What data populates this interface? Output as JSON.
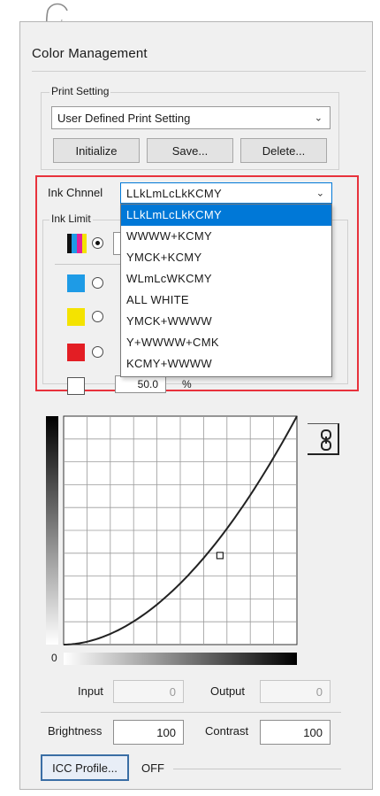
{
  "window": {
    "title": "Color Management"
  },
  "print_setting": {
    "legend": "Print Setting",
    "selected": "User Defined Print Setting",
    "buttons": {
      "initialize": "Initialize",
      "save": "Save...",
      "delete": "Delete..."
    }
  },
  "ink_channel": {
    "label": "Ink Chnnel",
    "selected": "LLkLmLcLkKCMY",
    "options": [
      "LLkLmLcLkKCMY",
      "WWWW+KCMY",
      "YMCK+KCMY",
      "WLmLcWKCMY",
      "ALL WHITE",
      "YMCK+WWWW",
      "Y+WWWW+CMK",
      "KCMY+WWWW"
    ]
  },
  "ink_limit": {
    "legend": "Ink Limit",
    "channels": [
      {
        "name": "all-colors",
        "selected": true
      },
      {
        "name": "cyan",
        "color": "#1e9be6",
        "selected": false
      },
      {
        "name": "yellow",
        "color": "#f4e300",
        "selected": false
      },
      {
        "name": "red",
        "color": "#e31e24",
        "selected": false
      },
      {
        "name": "white",
        "color": "#ffffff",
        "selected": false
      }
    ],
    "value": "50.0",
    "unit": "%"
  },
  "curve": {
    "origin_label": "0",
    "input_label": "Input",
    "input_value": "0",
    "output_label": "Output",
    "output_value": "0",
    "control_point": {
      "input_fraction": 0.67,
      "output_fraction": 0.39
    }
  },
  "adjustments": {
    "brightness_label": "Brightness",
    "brightness_value": "100",
    "contrast_label": "Contrast",
    "contrast_value": "100"
  },
  "icc": {
    "button": "ICC Profile...",
    "status": "OFF"
  },
  "colors": {
    "highlight": "#0078d7",
    "emphasis_border": "#e8323c"
  }
}
